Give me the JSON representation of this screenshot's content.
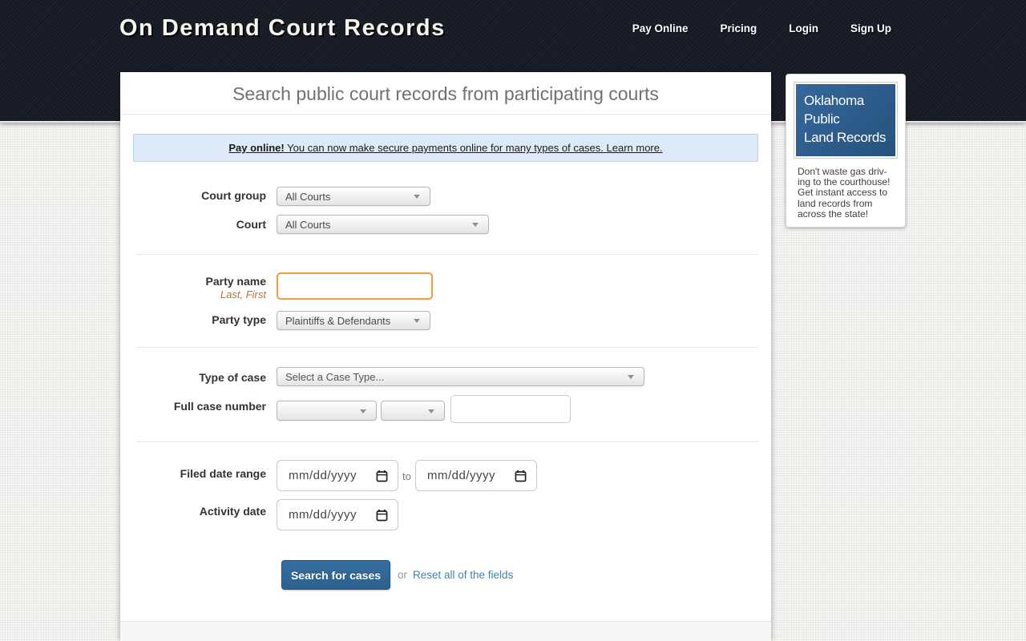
{
  "header": {
    "logo": "On Demand Court Records",
    "nav": [
      {
        "label": "Pay Online"
      },
      {
        "label": "Pricing"
      },
      {
        "label": "Login"
      },
      {
        "label": "Sign Up"
      }
    ]
  },
  "main": {
    "title": "Search public court records from participating courts",
    "banner": {
      "bold": "Pay online!",
      "text": " You can now make secure payments online for many types of cases. ",
      "link": "Learn more."
    },
    "form": {
      "court_group": {
        "label": "Court group",
        "value": "All Courts"
      },
      "court": {
        "label": "Court",
        "value": "All Courts"
      },
      "party_name": {
        "label": "Party name",
        "hint": "Last, First",
        "value": ""
      },
      "party_type": {
        "label": "Party type",
        "value": "Plaintiffs & Defendants"
      },
      "case_type": {
        "label": "Type of case",
        "value": "Select a Case Type..."
      },
      "case_number": {
        "label": "Full case number",
        "select1_value": "",
        "select2_value": "",
        "input_value": ""
      },
      "filed_date_range": {
        "label": "Filed date range",
        "from_placeholder": "mm/dd/yyyy",
        "joiner": "to",
        "to_placeholder": "mm/dd/yyyy"
      },
      "activity_date": {
        "label": "Activity date",
        "placeholder": "mm/dd/yyyy"
      },
      "actions": {
        "submit": "Search for cases",
        "or": "or",
        "reset": "Reset all of the fields"
      }
    }
  },
  "sidebar": {
    "ad_title_lines": [
      "Oklahoma",
      "Public",
      "Land Records"
    ],
    "ad_text_lines": [
      "Don't waste gas driv-",
      "ing to the courthouse!",
      "Get instant access to",
      "land records from",
      "across the state!"
    ]
  },
  "colors": {
    "header_bg": "#181c27",
    "button_blue": "#2c618f",
    "link_blue": "#3d85b0",
    "banner_bg": "#dcebf7",
    "banner_border": "#b7d4ea",
    "hint_orange": "#bd732d",
    "focused_input_border": "#e5a052",
    "ad_blue": "#2d5f92"
  }
}
